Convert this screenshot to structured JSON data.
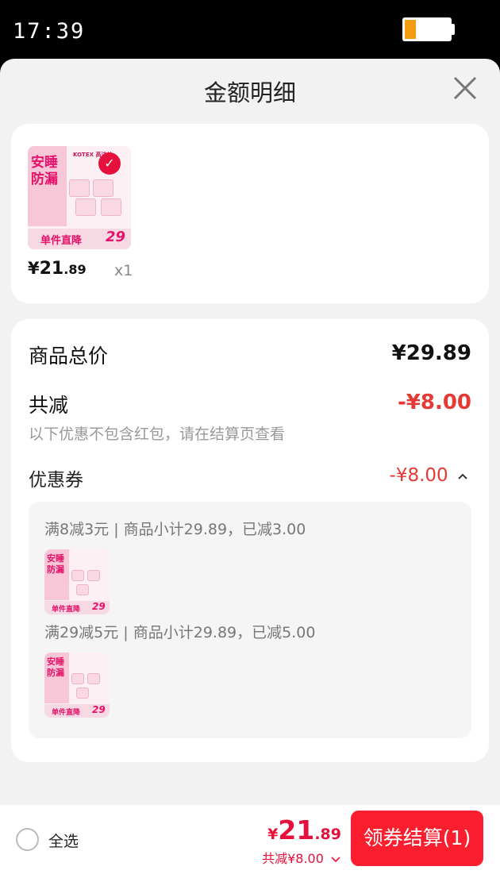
{
  "status_bar": {
    "time": "17:39"
  },
  "sheet": {
    "title": "金额明细"
  },
  "product": {
    "thumbnail": {
      "headline_1": "安睡",
      "headline_2": "防漏",
      "brand": "KOTEX 高洁丝",
      "ribbon": "单件直降",
      "price_tag": "29"
    },
    "price_symbol": "¥",
    "price_int": "21",
    "price_dec": ".89",
    "quantity": "x1"
  },
  "detail": {
    "total_label": "商品总价",
    "total_value": "¥29.89",
    "discount_label": "共减",
    "discount_value": "-¥8.00",
    "note": "以下优惠不包含红包，请在结算页查看",
    "coupon_label": "优惠券",
    "coupon_value": "-¥8.00",
    "coupons": [
      {
        "desc": "满8减3元 | 商品小计29.89，已减3.00"
      },
      {
        "desc": "满29减5元 | 商品小计29.89，已减5.00"
      }
    ]
  },
  "bottom_bar": {
    "select_all_label": "全选",
    "price_symbol": "¥",
    "price_int": "21",
    "price_dec": ".89",
    "discount_text": "共减¥8.00",
    "checkout_label": "领券结算(1)"
  },
  "colors": {
    "accent_red": "#fa1e2f",
    "discount_red": "#e53935",
    "battery": "#f39c12"
  },
  "battery_level": 0.25
}
